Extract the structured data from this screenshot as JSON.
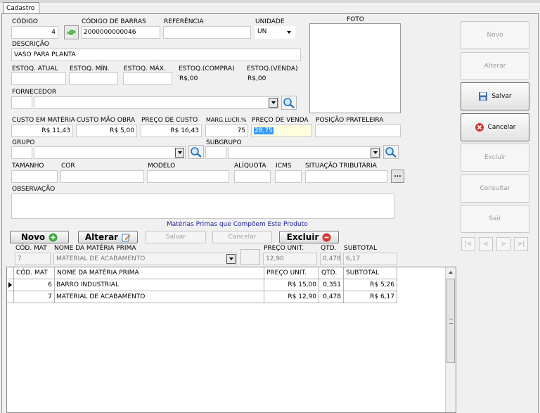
{
  "tab": {
    "label": "Cadastro"
  },
  "form": {
    "codigo": {
      "label": "CÓDIGO",
      "value": "4"
    },
    "codigo_barras": {
      "label": "CÓDIGO DE BARRAS",
      "value": "2000000000046"
    },
    "referencia": {
      "label": "REFERÊNCIA",
      "value": ""
    },
    "unidade": {
      "label": "UNIDADE",
      "value": "UN"
    },
    "foto": {
      "label": "FOTO"
    },
    "descricao": {
      "label": "DESCRIÇÃO",
      "value": "VASO PARA PLANTA"
    },
    "estoq_atual": {
      "label": "ESTOQ. ATUAL",
      "value": ""
    },
    "estoq_min": {
      "label": "ESTOQ. MÍN.",
      "value": ""
    },
    "estoq_max": {
      "label": "ESTOQ. MÁX.",
      "value": ""
    },
    "estoq_compra": {
      "label": "ESTOQ.(COMPRA)",
      "value": "R$,00"
    },
    "estoq_venda": {
      "label": "ESTOQ.(VENDA)",
      "value": "R$,00"
    },
    "fornecedor": {
      "label": "FORNECEDOR",
      "code": "",
      "name": ""
    },
    "custo_materia": {
      "label": "CUSTO EM MATÉRIA",
      "value": "R$ 11,43"
    },
    "custo_mao_obra": {
      "label": "CUSTO MÃO OBRA",
      "value": "R$ 5,00"
    },
    "preco_custo": {
      "label": "PREÇO DE CUSTO",
      "value": "R$ 16,43"
    },
    "marg_lucr": {
      "label": "MARG.LUCR.%",
      "value": "75"
    },
    "preco_venda": {
      "label": "PREÇO DE VENDA",
      "value": "28,75"
    },
    "posicao_prateleira": {
      "label": "POSIÇÃO PRATELEIRA",
      "value": ""
    },
    "grupo": {
      "label": "GRUPO",
      "code": "",
      "name": ""
    },
    "subgrupo": {
      "label": "SUBGRUPO",
      "code": "",
      "name": ""
    },
    "tamanho": {
      "label": "TAMANHO",
      "value": ""
    },
    "cor": {
      "label": "COR",
      "value": ""
    },
    "modelo": {
      "label": "MODELO",
      "value": ""
    },
    "aliquota": {
      "label": "ALÍQUOTA",
      "value": ""
    },
    "icms": {
      "label": "ICMS",
      "value": ""
    },
    "situacao_tributaria": {
      "label": "SITUAÇÃO TRIBUTÁRIA",
      "value": "",
      "button": "..."
    },
    "observacao": {
      "label": "OBSERVAÇÃO",
      "value": ""
    }
  },
  "side_buttons": {
    "novo": "Novo",
    "alterar": "Alterar",
    "salvar": "Salvar",
    "cancelar": "Cancelar",
    "excluir": "Excluir",
    "consultar": "Consultar",
    "sair": "Sair"
  },
  "nav": {
    "first": "|<",
    "prev": "<",
    "next": ">",
    "last": ">|"
  },
  "materias": {
    "title": "Matérias Primas que Compõem Este Produto",
    "buttons": {
      "novo": "Novo",
      "alterar": "Alterar",
      "salvar": "Salvar",
      "cancelar": "Cancelar",
      "excluir": "Excluir"
    },
    "edit": {
      "cod_label": "CÓD. MAT",
      "cod_value": "7",
      "nome_label": "NOME DA MATÉRIA PRIMA",
      "nome_value": "MATERIAL DE ACABAMENTO",
      "preco_label": "PREÇO UNIT.",
      "preco_value": "12,90",
      "qtd_label": "QTD.",
      "qtd_value": "0,478",
      "subtotal_label": "SUBTOTAL",
      "subtotal_value": "6,17"
    },
    "grid": {
      "headers": [
        "CÓD. MAT",
        "NOME DA MATÉRIA PRIMA",
        "PREÇO UNIT.",
        "QTD.",
        "SUBTOTAL"
      ],
      "rows": [
        {
          "cod": "6",
          "nome": "BARRO INDUSTRIAL",
          "preco": "R$ 15,00",
          "qtd": "0,351",
          "subtotal": "R$ 5,26"
        },
        {
          "cod": "7",
          "nome": "MATERIAL DE ACABAMENTO",
          "preco": "R$ 12,90",
          "qtd": "0,478",
          "subtotal": "R$ 6,17"
        }
      ]
    }
  },
  "colors": {
    "selection": "#3399ff",
    "highlight_field": "#ffffe0",
    "title_blue": "#1f1f9a"
  }
}
